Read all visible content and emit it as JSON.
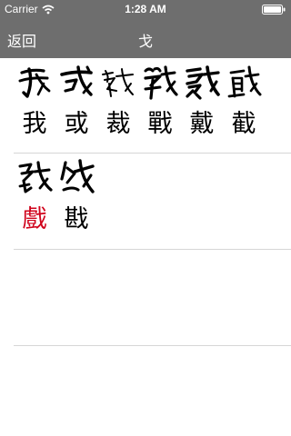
{
  "status_bar": {
    "carrier": "Carrier",
    "time": "1:28 AM"
  },
  "nav": {
    "back_label": "返回",
    "title": "戈"
  },
  "rows": [
    {
      "chars": [
        {
          "char": "我",
          "color": "#000000"
        },
        {
          "char": "或",
          "color": "#000000"
        },
        {
          "char": "裁",
          "color": "#000000"
        },
        {
          "char": "戰",
          "color": "#000000"
        },
        {
          "char": "戴",
          "color": "#000000"
        },
        {
          "char": "截",
          "color": "#000000"
        }
      ]
    },
    {
      "chars": [
        {
          "char": "戲",
          "color": "#d0021b"
        },
        {
          "char": "戡",
          "color": "#000000"
        }
      ]
    }
  ],
  "colors": {
    "bar_background": "#6e6e6e",
    "highlight": "#d0021b",
    "separator": "#d6d6d6"
  }
}
